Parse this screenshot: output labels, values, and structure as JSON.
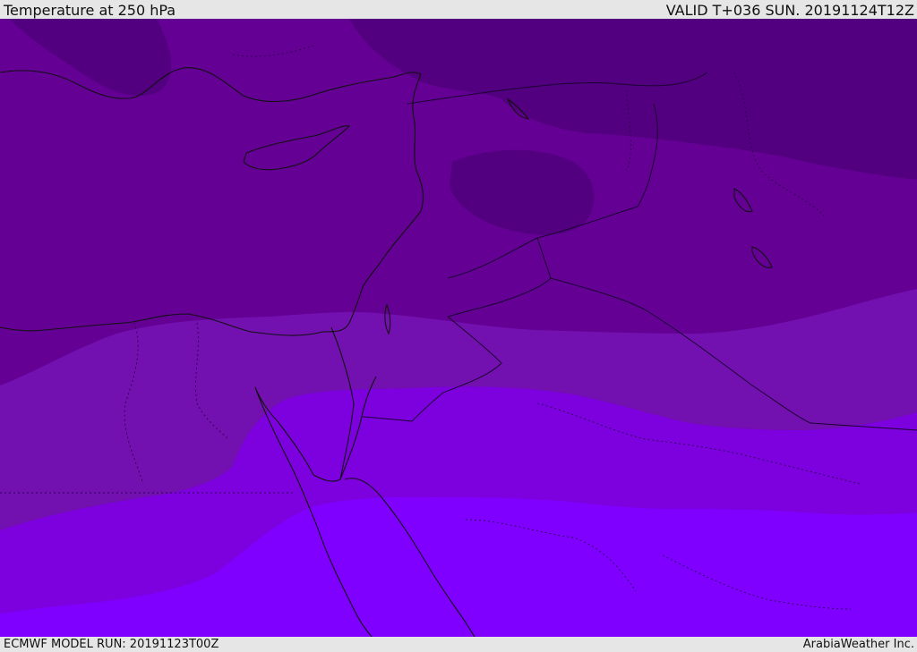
{
  "header": {
    "title": "Temperature at 250 hPa",
    "valid": "VALID T+036 SUN. 20191124T12Z"
  },
  "footer": {
    "model_run": "ECMWF MODEL RUN: 20191123T00Z",
    "credit": "ArabiaWeather Inc."
  },
  "map": {
    "region": "Eastern Mediterranean / Middle East",
    "variable": "temperature",
    "level": "250 hPa",
    "colors": {
      "band_coldest": "#52007f",
      "band_cold": "#640094",
      "band_cool": "#7310b0",
      "band_mild": "#7d00de",
      "band_warm": "#7f00ff",
      "coastline": "#111111",
      "border": "#2a0a40"
    }
  }
}
